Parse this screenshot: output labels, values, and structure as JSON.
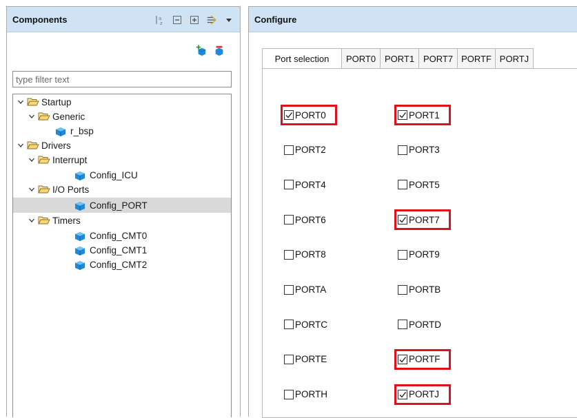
{
  "components_panel": {
    "title": "Components",
    "filter_placeholder": "type filter text",
    "tree": [
      {
        "label": "Startup",
        "type": "folder",
        "expanded": true,
        "level": 0
      },
      {
        "label": "Generic",
        "type": "folder",
        "expanded": true,
        "level": 1
      },
      {
        "label": "r_bsp",
        "type": "component",
        "level": 2
      },
      {
        "label": "Drivers",
        "type": "folder",
        "expanded": true,
        "level": 0
      },
      {
        "label": "Interrupt",
        "type": "folder",
        "expanded": true,
        "level": 1
      },
      {
        "label": "Config_ICU",
        "type": "component",
        "level": 2
      },
      {
        "label": "I/O Ports",
        "type": "folder",
        "expanded": true,
        "level": 1
      },
      {
        "label": "Config_PORT",
        "type": "component",
        "level": 2,
        "selected": true
      },
      {
        "label": "Timers",
        "type": "folder",
        "expanded": true,
        "level": 1
      },
      {
        "label": "Config_CMT0",
        "type": "component",
        "level": 2
      },
      {
        "label": "Config_CMT1",
        "type": "component",
        "level": 2
      },
      {
        "label": "Config_CMT2",
        "type": "component",
        "level": 2
      }
    ],
    "toolbar_icons": [
      "sort-alpha-icon",
      "collapse-all-icon",
      "expand-all-icon",
      "filter-options-icon",
      "dropdown-arrow-icon"
    ],
    "action_icons": [
      "add-component-icon",
      "remove-component-icon"
    ]
  },
  "configure_panel": {
    "title": "Configure",
    "tabs": [
      {
        "label": "Port selection",
        "active": true
      },
      {
        "label": "PORT0",
        "active": false
      },
      {
        "label": "PORT1",
        "active": false
      },
      {
        "label": "PORT7",
        "active": false
      },
      {
        "label": "PORTF",
        "active": false
      },
      {
        "label": "PORTJ",
        "active": false
      }
    ],
    "ports": [
      {
        "label": "PORT0",
        "checked": true,
        "highlighted": true
      },
      {
        "label": "PORT1",
        "checked": true,
        "highlighted": true
      },
      {
        "label": "PORT2",
        "checked": false,
        "highlighted": false
      },
      {
        "label": "PORT3",
        "checked": false,
        "highlighted": false
      },
      {
        "label": "PORT4",
        "checked": false,
        "highlighted": false
      },
      {
        "label": "PORT5",
        "checked": false,
        "highlighted": false
      },
      {
        "label": "PORT6",
        "checked": false,
        "highlighted": false
      },
      {
        "label": "PORT7",
        "checked": true,
        "highlighted": true
      },
      {
        "label": "PORT8",
        "checked": false,
        "highlighted": false
      },
      {
        "label": "PORT9",
        "checked": false,
        "highlighted": false
      },
      {
        "label": "PORTA",
        "checked": false,
        "highlighted": false
      },
      {
        "label": "PORTB",
        "checked": false,
        "highlighted": false
      },
      {
        "label": "PORTC",
        "checked": false,
        "highlighted": false
      },
      {
        "label": "PORTD",
        "checked": false,
        "highlighted": false
      },
      {
        "label": "PORTE",
        "checked": false,
        "highlighted": false
      },
      {
        "label": "PORTF",
        "checked": true,
        "highlighted": true
      },
      {
        "label": "PORTH",
        "checked": false,
        "highlighted": false
      },
      {
        "label": "PORTJ",
        "checked": true,
        "highlighted": true
      }
    ]
  },
  "colors": {
    "header_bg": "#cfe3f5",
    "selected_row": "#d9d9d9",
    "highlight_border": "#e0101a",
    "folder_stroke": "#8a6a1f",
    "component_icon": "#1f8ad9"
  }
}
